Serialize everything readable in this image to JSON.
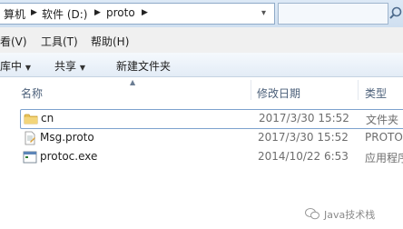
{
  "address": {
    "crumbs": [
      "算机",
      "软件 (D:)",
      "proto"
    ]
  },
  "menu": [
    "看(V)",
    "工具(T)",
    "帮助(H)"
  ],
  "toolbar": {
    "organize": "库中",
    "share": "共享",
    "new_folder": "新建文件夹"
  },
  "columns": {
    "name": "名称",
    "date": "修改日期",
    "type": "类型"
  },
  "files": [
    {
      "name": "cn",
      "date": "2017/3/30 15:52",
      "type": "文件夹",
      "icon": "folder-icon"
    },
    {
      "name": "Msg.proto",
      "date": "2017/3/30 15:52",
      "type": "PROTO",
      "icon": "text-file-icon"
    },
    {
      "name": "protoc.exe",
      "date": "2014/10/22 6:53",
      "type": "应用程序",
      "icon": "exe-file-icon"
    }
  ],
  "watermark": {
    "text": "Java技术栈"
  },
  "colors": {
    "folder": "#e8c25a",
    "selection_border": "#7da2ce",
    "header_text": "#4c607a"
  }
}
